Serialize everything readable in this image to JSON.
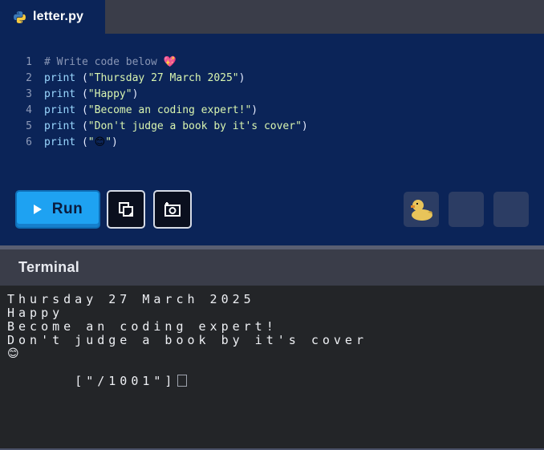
{
  "tab": {
    "filename": "letter.py",
    "icon": "python-icon"
  },
  "editor": {
    "lines": [
      {
        "num": "1",
        "comment": "# Write code below ",
        "emoji": "💖"
      },
      {
        "num": "2",
        "kw": "print",
        "open": " (",
        "str": "\"Thursday 27 March 2025\"",
        "close": ")"
      },
      {
        "num": "3",
        "kw": "print",
        "open": " (",
        "str": "\"Happy\"",
        "close": ")"
      },
      {
        "num": "4",
        "kw": "print",
        "open": " (",
        "str": "\"Become an coding expert!\"",
        "close": ")"
      },
      {
        "num": "5",
        "kw": "print",
        "open": " (",
        "str": "\"Don't judge a book by it's cover\"",
        "close": ")"
      },
      {
        "num": "6",
        "kw": "print",
        "open": " (",
        "str_open": "\"",
        "emoji": "😊",
        "str_close": "\"",
        "close": ")"
      }
    ]
  },
  "toolbar": {
    "run_label": "Run",
    "copy_icon": "copy-icon",
    "screenshot_icon": "screenshot-icon",
    "duck_icon": "rubber-duck-icon"
  },
  "terminal": {
    "title": "Terminal",
    "output": [
      "Thursday 27 March 2025",
      "Happy",
      "Become an coding expert!",
      "Don't judge a book by it's cover"
    ],
    "emoji_line": "😊",
    "prompt": "[\"/1001\"]"
  },
  "colors": {
    "editor_bg": "#0b2458",
    "run_button": "#1ea2f2",
    "terminal_bg": "#232528",
    "header_bg": "#3a3d49"
  }
}
